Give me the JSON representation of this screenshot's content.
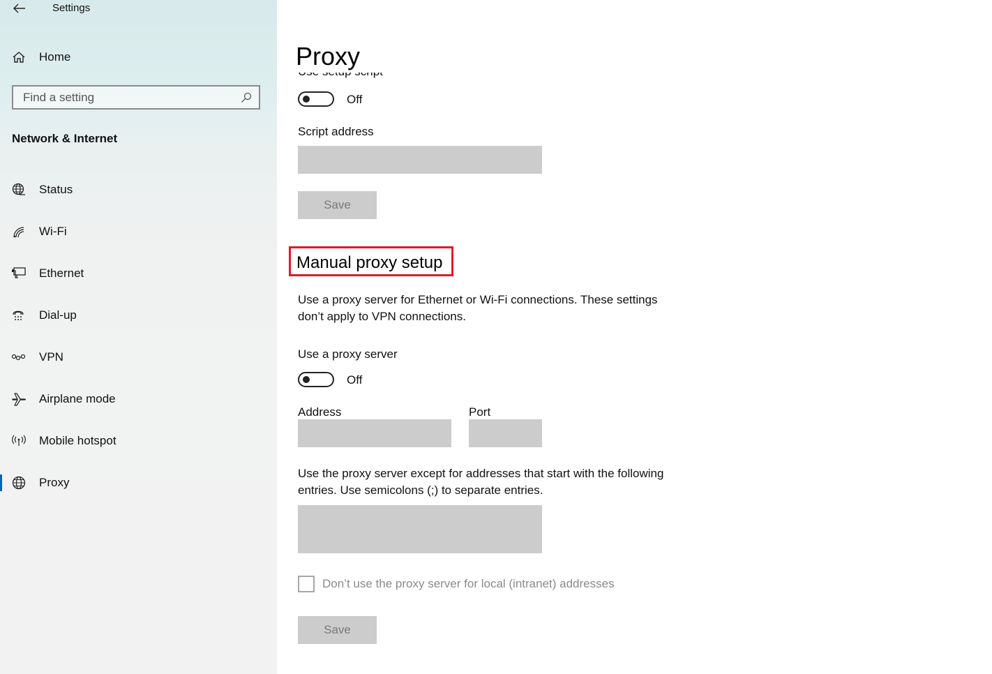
{
  "window": {
    "title": "Settings"
  },
  "sidebar": {
    "home_label": "Home",
    "search_placeholder": "Find a setting",
    "group_title": "Network & Internet",
    "items": [
      {
        "label": "Status",
        "icon": "globe-status-icon"
      },
      {
        "label": "Wi-Fi",
        "icon": "wifi-icon"
      },
      {
        "label": "Ethernet",
        "icon": "ethernet-icon"
      },
      {
        "label": "Dial-up",
        "icon": "dialup-icon"
      },
      {
        "label": "VPN",
        "icon": "vpn-icon"
      },
      {
        "label": "Airplane mode",
        "icon": "airplane-icon"
      },
      {
        "label": "Mobile hotspot",
        "icon": "hotspot-icon"
      },
      {
        "label": "Proxy",
        "icon": "globe-icon",
        "selected": true
      }
    ]
  },
  "main": {
    "page_title": "Proxy",
    "script_section": {
      "toggle_label": "Use setup script",
      "toggle_state": "Off",
      "script_address_label": "Script address",
      "script_address_value": "",
      "save_label": "Save"
    },
    "manual": {
      "heading": "Manual proxy setup",
      "description_line1": "Use a proxy server for Ethernet or Wi-Fi connections. These settings",
      "description_line2": "don’t apply to VPN connections.",
      "use_proxy_label": "Use a proxy server",
      "use_proxy_state": "Off",
      "address_label": "Address",
      "address_value": "",
      "port_label": "Port",
      "port_value": "",
      "exceptions_line1": "Use the proxy server except for addresses that start with the following",
      "exceptions_line2": "entries. Use semicolons (;) to separate entries.",
      "exceptions_value": "",
      "local_checkbox_label": "Don’t use the proxy server for local (intranet) addresses",
      "local_checkbox_checked": false,
      "save_label": "Save"
    }
  },
  "colors": {
    "highlight_border": "#e01b24",
    "accent": "#0067c0",
    "disabled_fill": "#cccccc"
  }
}
